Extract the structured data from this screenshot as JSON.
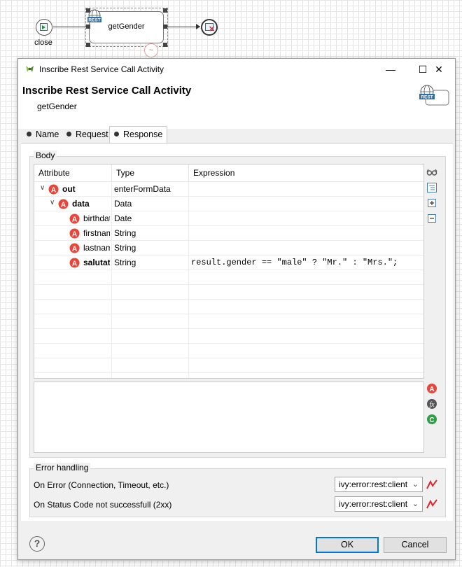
{
  "canvas": {
    "start_event_label": "close",
    "activity_label": "getGender",
    "activity_badge": "REST"
  },
  "dialog": {
    "window_title": "Inscribe Rest Service Call Activity",
    "header_title": "Inscribe Rest Service Call Activity",
    "header_subtitle": "getGender",
    "header_badge": "REST",
    "window_buttons": {
      "minimize": "—",
      "maximize": "☐",
      "close": "✕"
    },
    "tabs": [
      {
        "label": "Name",
        "active": false
      },
      {
        "label": "Request",
        "active": false
      },
      {
        "label": "Response",
        "active": true
      }
    ],
    "body": {
      "title": "Body",
      "columns": [
        "Attribute",
        "Type",
        "Expression"
      ],
      "rows": [
        {
          "attribute": "out",
          "type": "enterFormData",
          "expression": "",
          "bold": true,
          "expand": "v",
          "indent": 0
        },
        {
          "attribute": "data",
          "type": "Data",
          "expression": "",
          "bold": true,
          "expand": "v",
          "indent": 1
        },
        {
          "attribute": "birthdate",
          "type": "Date",
          "expression": "",
          "bold": false,
          "indent": 2
        },
        {
          "attribute": "firstname",
          "type": "String",
          "expression": "",
          "bold": false,
          "indent": 2
        },
        {
          "attribute": "lastname",
          "type": "String",
          "expression": "",
          "bold": false,
          "indent": 2
        },
        {
          "attribute": "salutation",
          "type": "String",
          "expression": "result.gender == \"male\" ? \"Mr.\" : \"Mrs.\";",
          "bold": true,
          "indent": 2
        }
      ],
      "side_tools": [
        "glasses-icon",
        "collapse-all-icon",
        "expand-all-icon",
        "collapse-icon"
      ],
      "editor_tools": [
        "attribute-icon",
        "function-icon",
        "class-icon"
      ]
    },
    "error_handling": {
      "title": "Error handling",
      "rows": [
        {
          "label": "On Error (Connection, Timeout, etc.)",
          "value": "ivy:error:rest:client"
        },
        {
          "label": "On Status Code not successfull (2xx)",
          "value": "ivy:error:rest:client"
        }
      ]
    },
    "footer": {
      "help": "?",
      "ok": "OK",
      "cancel": "Cancel"
    },
    "colors": {
      "attribute_icon": "#e8463a",
      "accent": "#0078d7",
      "error_zigzag": "#e0252b",
      "rest_badge": "#2d6ea3"
    }
  }
}
